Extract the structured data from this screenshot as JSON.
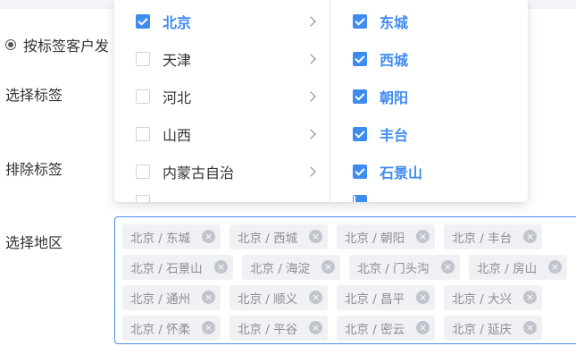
{
  "form": {
    "radio_label": "按标签客户发",
    "select_tags_label": "选择标签",
    "exclude_tags_label": "排除标签",
    "select_region_label": "选择地区"
  },
  "cascader": {
    "provinces": [
      {
        "label": "北京",
        "checked": true,
        "selected": true
      },
      {
        "label": "天津",
        "checked": false,
        "selected": false
      },
      {
        "label": "河北",
        "checked": false,
        "selected": false
      },
      {
        "label": "山西",
        "checked": false,
        "selected": false
      },
      {
        "label": "内蒙古自治",
        "checked": false,
        "selected": false
      }
    ],
    "districts": [
      {
        "label": "东城",
        "checked": true
      },
      {
        "label": "西城",
        "checked": true
      },
      {
        "label": "朝阳",
        "checked": true
      },
      {
        "label": "丰台",
        "checked": true
      },
      {
        "label": "石景山",
        "checked": true
      }
    ]
  },
  "selected_regions": [
    "北京 / 东城",
    "北京 / 西城",
    "北京 / 朝阳",
    "北京 / 丰台",
    "北京 / 石景山",
    "北京 / 海淀",
    "北京 / 门头沟",
    "北京 / 房山",
    "北京 / 通州",
    "北京 / 顺义",
    "北京 / 昌平",
    "北京 / 大兴",
    "北京 / 怀柔",
    "北京 / 平谷",
    "北京 / 密云",
    "北京 / 延庆"
  ],
  "colors": {
    "accent": "#3f8cf0",
    "tag_bg": "#f0f1f4",
    "tag_text": "#8a8e96"
  }
}
